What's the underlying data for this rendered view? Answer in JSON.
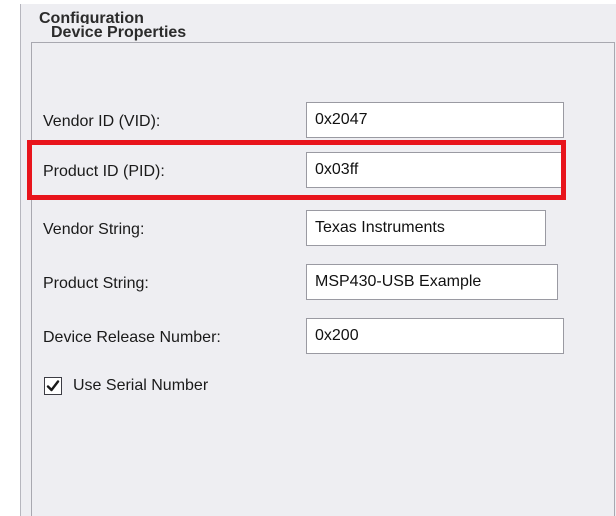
{
  "configuration": {
    "title": "Configuration"
  },
  "device_properties": {
    "title": "Device Properties",
    "fields": [
      {
        "label": "Vendor ID (VID):",
        "value": "0x2047"
      },
      {
        "label": "Product ID (PID):",
        "value": "0x03ff"
      },
      {
        "label": "Vendor String:",
        "value": "Texas Instruments"
      },
      {
        "label": "Product String:",
        "value": "MSP430-USB Example"
      },
      {
        "label": "Device Release Number:",
        "value": "0x200"
      }
    ],
    "use_serial_number": {
      "label": "Use Serial Number",
      "checked": true
    },
    "highlight_color": "#e8141c"
  }
}
